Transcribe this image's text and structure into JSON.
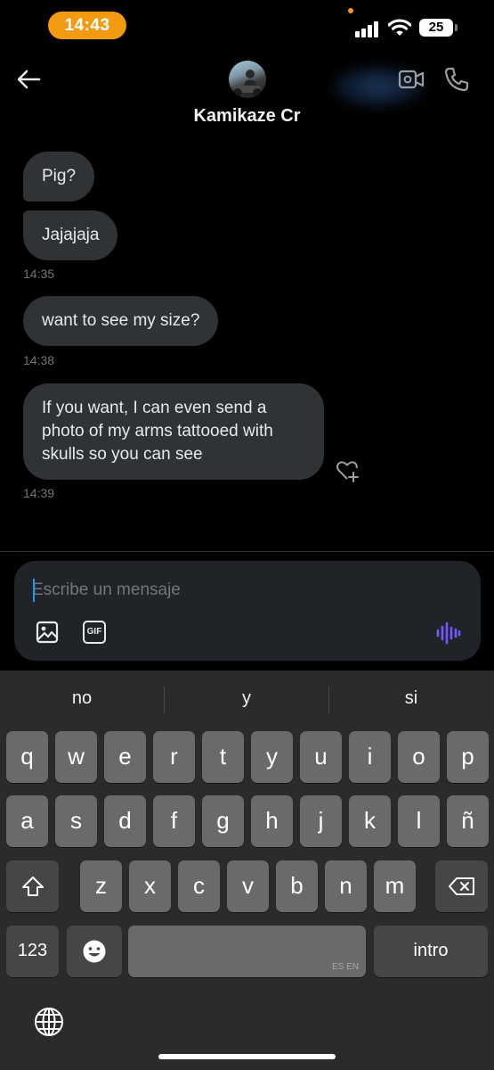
{
  "status_bar": {
    "time": "14:43",
    "battery": "25",
    "icons": [
      "signal-icon",
      "wifi-icon",
      "battery-icon"
    ]
  },
  "header": {
    "contact_name": "Kamikaze Cr",
    "back_icon": "back-arrow-icon",
    "video_icon": "video-call-icon",
    "call_icon": "phone-icon"
  },
  "messages": [
    {
      "text": "Pig?"
    },
    {
      "text": "Jajajaja"
    },
    {
      "text": "want to see my size?"
    },
    {
      "text": "If you want, I can even send a\nphoto of my arms tattooed with\nskulls so you can see"
    }
  ],
  "timestamps": [
    "14:35",
    "14:38",
    "14:39"
  ],
  "composer": {
    "placeholder": "Escribe un mensaje",
    "gif_label": "GIF",
    "accent": "#7856ff",
    "cursor_color": "#1d9bf0"
  },
  "keyboard": {
    "suggestions": [
      "no",
      "y",
      "si"
    ],
    "row1": [
      "q",
      "w",
      "e",
      "r",
      "t",
      "y",
      "u",
      "i",
      "o",
      "p"
    ],
    "row2": [
      "a",
      "s",
      "d",
      "f",
      "g",
      "h",
      "j",
      "k",
      "l",
      "ñ"
    ],
    "row3": [
      "z",
      "x",
      "c",
      "v",
      "b",
      "n",
      "m"
    ],
    "numbers_key": "123",
    "space_lang": "ES EN",
    "return_key": "intro"
  },
  "colors": {
    "background": "#000000",
    "bubble": "#2f3336",
    "time_pill": "#f29a12",
    "keyboard_bg": "#2b2b2b"
  }
}
